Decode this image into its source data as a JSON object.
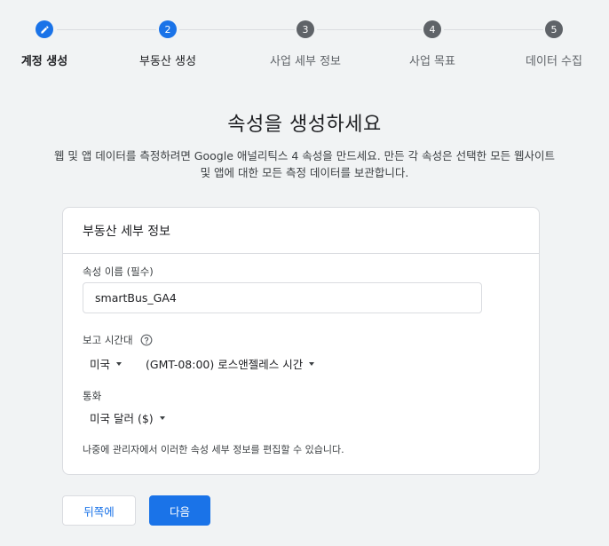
{
  "stepper": {
    "steps": [
      {
        "number": "",
        "label": "계정 생성",
        "state": "done",
        "icon": "pencil-icon"
      },
      {
        "number": "2",
        "label": "부동산 생성",
        "state": "current"
      },
      {
        "number": "3",
        "label": "사업 세부 정보",
        "state": "todo"
      },
      {
        "number": "4",
        "label": "사업 목표",
        "state": "todo"
      },
      {
        "number": "5",
        "label": "데이터 수집",
        "state": "todo"
      }
    ],
    "active_color": "#1a73e8",
    "inactive_color": "#5f6368"
  },
  "page": {
    "title": "속성을 생성하세요",
    "description_line1": "웹 및 앱 데이터를 측정하려면 Google 애널리틱스 4 속성을 만드세요. 만든 각 속성은 선택한 모든 웹사이트",
    "description_line2": "및 앱에 대한 모든 측정 데이터를 보관합니다."
  },
  "card": {
    "title": "부동산 세부 정보",
    "property_name_label": "속성 이름 (필수)",
    "property_name_value": "smartBus_GA4",
    "reporting_timezone_label": "보고 시간대",
    "help_icon": "help-circle-icon",
    "country_value": "미국",
    "timezone_value": "(GMT-08:00) 로스앤젤레스 시간",
    "currency_label": "통화",
    "currency_value": "미국 달러 ($)",
    "note": "나중에 관리자에서 이러한 속성 세부 정보를 편집할 수 있습니다."
  },
  "buttons": {
    "back_label": "뒤쪽에",
    "next_label": "다음"
  }
}
